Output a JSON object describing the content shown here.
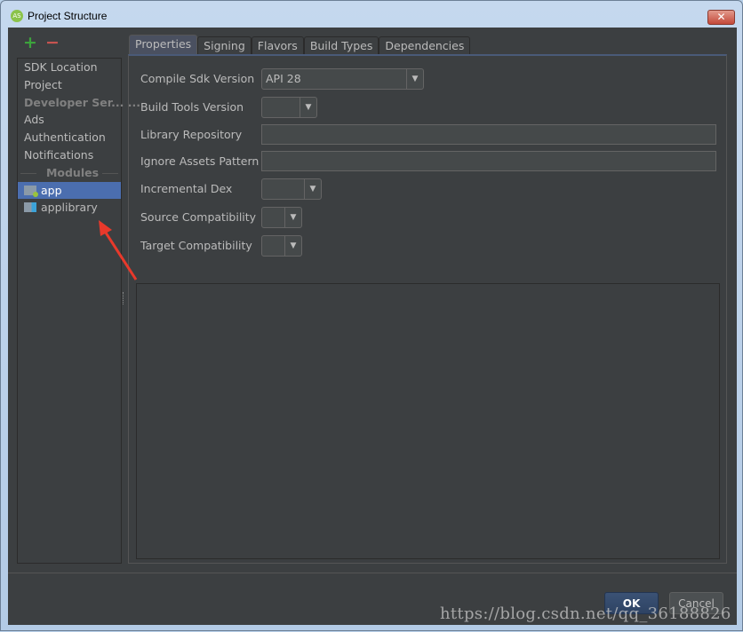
{
  "window": {
    "title": "Project Structure",
    "close_label": "✕"
  },
  "toolbar": {
    "add": "+",
    "remove": "−"
  },
  "sidebar": {
    "items": [
      {
        "label": "SDK Location",
        "type": "item"
      },
      {
        "label": "Project",
        "type": "item"
      },
      {
        "label": "Developer Ser... ...",
        "type": "header"
      },
      {
        "label": "Ads",
        "type": "item"
      },
      {
        "label": "Authentication",
        "type": "item"
      },
      {
        "label": "Notifications",
        "type": "item"
      }
    ],
    "modules_header": "Modules",
    "modules": [
      {
        "label": "app",
        "selected": true
      },
      {
        "label": "applibrary",
        "selected": false
      }
    ]
  },
  "tabs": [
    "Properties",
    "Signing",
    "Flavors",
    "Build Types",
    "Dependencies"
  ],
  "active_tab": "Properties",
  "form": {
    "compile_sdk": {
      "label": "Compile Sdk Version",
      "value": "API 28"
    },
    "build_tools": {
      "label": "Build Tools Version",
      "value": ""
    },
    "library_repo": {
      "label": "Library Repository",
      "value": ""
    },
    "ignore_assets": {
      "label": "Ignore Assets Pattern",
      "value": ""
    },
    "incremental_dex": {
      "label": "Incremental Dex",
      "value": ""
    },
    "source_compat": {
      "label": "Source Compatibility",
      "value": ""
    },
    "target_compat": {
      "label": "Target Compatibility",
      "value": ""
    }
  },
  "buttons": {
    "ok": "OK",
    "cancel": "Cancel"
  },
  "watermark": "https://blog.csdn.net/qq_36188826",
  "colors": {
    "accent": "#4b6eaf",
    "bg": "#3c3f41",
    "arrow": "#e8392b"
  }
}
